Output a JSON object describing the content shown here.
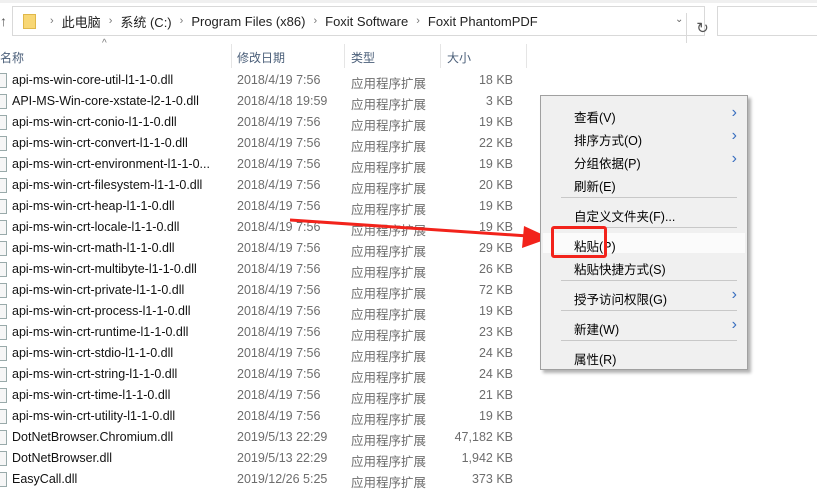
{
  "address": {
    "crumbs": [
      "此电脑",
      "系统 (C:)",
      "Program Files (x86)",
      "Foxit Software",
      "Foxit PhantomPDF"
    ]
  },
  "columns": {
    "name": "名称",
    "date": "修改日期",
    "type": "类型",
    "size": "大小"
  },
  "files": [
    {
      "name": "api-ms-win-core-util-l1-1-0.dll",
      "date": "2018/4/19 7:56",
      "type": "应用程序扩展",
      "size": "18 KB"
    },
    {
      "name": "API-MS-Win-core-xstate-l2-1-0.dll",
      "date": "2018/4/18 19:59",
      "type": "应用程序扩展",
      "size": "3 KB"
    },
    {
      "name": "api-ms-win-crt-conio-l1-1-0.dll",
      "date": "2018/4/19 7:56",
      "type": "应用程序扩展",
      "size": "19 KB"
    },
    {
      "name": "api-ms-win-crt-convert-l1-1-0.dll",
      "date": "2018/4/19 7:56",
      "type": "应用程序扩展",
      "size": "22 KB"
    },
    {
      "name": "api-ms-win-crt-environment-l1-1-0...",
      "date": "2018/4/19 7:56",
      "type": "应用程序扩展",
      "size": "19 KB"
    },
    {
      "name": "api-ms-win-crt-filesystem-l1-1-0.dll",
      "date": "2018/4/19 7:56",
      "type": "应用程序扩展",
      "size": "20 KB"
    },
    {
      "name": "api-ms-win-crt-heap-l1-1-0.dll",
      "date": "2018/4/19 7:56",
      "type": "应用程序扩展",
      "size": "19 KB"
    },
    {
      "name": "api-ms-win-crt-locale-l1-1-0.dll",
      "date": "2018/4/19 7:56",
      "type": "应用程序扩展",
      "size": "19 KB"
    },
    {
      "name": "api-ms-win-crt-math-l1-1-0.dll",
      "date": "2018/4/19 7:56",
      "type": "应用程序扩展",
      "size": "29 KB"
    },
    {
      "name": "api-ms-win-crt-multibyte-l1-1-0.dll",
      "date": "2018/4/19 7:56",
      "type": "应用程序扩展",
      "size": "26 KB"
    },
    {
      "name": "api-ms-win-crt-private-l1-1-0.dll",
      "date": "2018/4/19 7:56",
      "type": "应用程序扩展",
      "size": "72 KB"
    },
    {
      "name": "api-ms-win-crt-process-l1-1-0.dll",
      "date": "2018/4/19 7:56",
      "type": "应用程序扩展",
      "size": "19 KB"
    },
    {
      "name": "api-ms-win-crt-runtime-l1-1-0.dll",
      "date": "2018/4/19 7:56",
      "type": "应用程序扩展",
      "size": "23 KB"
    },
    {
      "name": "api-ms-win-crt-stdio-l1-1-0.dll",
      "date": "2018/4/19 7:56",
      "type": "应用程序扩展",
      "size": "24 KB"
    },
    {
      "name": "api-ms-win-crt-string-l1-1-0.dll",
      "date": "2018/4/19 7:56",
      "type": "应用程序扩展",
      "size": "24 KB"
    },
    {
      "name": "api-ms-win-crt-time-l1-1-0.dll",
      "date": "2018/4/19 7:56",
      "type": "应用程序扩展",
      "size": "21 KB"
    },
    {
      "name": "api-ms-win-crt-utility-l1-1-0.dll",
      "date": "2018/4/19 7:56",
      "type": "应用程序扩展",
      "size": "19 KB"
    },
    {
      "name": "DotNetBrowser.Chromium.dll",
      "date": "2019/5/13 22:29",
      "type": "应用程序扩展",
      "size": "47,182 KB"
    },
    {
      "name": "DotNetBrowser.dll",
      "date": "2019/5/13 22:29",
      "type": "应用程序扩展",
      "size": "1,942 KB"
    },
    {
      "name": "EasyCall.dll",
      "date": "2019/12/26 5:25",
      "type": "应用程序扩展",
      "size": "373 KB"
    }
  ],
  "menu": {
    "view": "查看(V)",
    "sort": "排序方式(O)",
    "group": "分组依据(P)",
    "refresh": "刷新(E)",
    "customize": "自定义文件夹(F)...",
    "paste": "粘贴(P)",
    "paste_shortcut": "粘贴快捷方式(S)",
    "grant_access": "授予访问权限(G)",
    "new": "新建(W)",
    "properties": "属性(R)"
  },
  "annotation_color": "#f2231b"
}
